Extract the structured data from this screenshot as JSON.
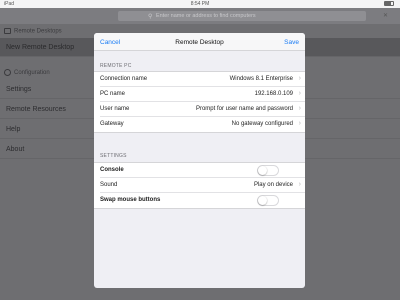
{
  "status_bar": {
    "carrier": "iPad",
    "time": "8:54 PM"
  },
  "search": {
    "placeholder": "Enter name or address to find computers"
  },
  "sidebar": {
    "remote_desktops_header": "Remote Desktops",
    "selected_item": "New Remote Desktop",
    "configuration_header": "Configuration",
    "items": [
      "Settings",
      "Remote Resources",
      "Help",
      "About"
    ]
  },
  "dialog": {
    "cancel_label": "Cancel",
    "title": "Remote Desktop",
    "save_label": "Save",
    "remote_pc_header": "REMOTE PC",
    "remote_pc_rows": [
      {
        "label": "Connection name",
        "value": "Windows 8.1 Enterprise"
      },
      {
        "label": "PC name",
        "value": "192.168.0.109"
      },
      {
        "label": "User name",
        "value": "Prompt for user name and password"
      },
      {
        "label": "Gateway",
        "value": "No gateway configured"
      }
    ],
    "settings_header": "SETTINGS",
    "console_label": "Console",
    "console_on": false,
    "sound_label": "Sound",
    "sound_value": "Play on device",
    "swap_label": "Swap mouse buttons",
    "swap_on": false
  },
  "colors": {
    "accent": "#1a7cf5",
    "overlay": "#6e6e71"
  }
}
